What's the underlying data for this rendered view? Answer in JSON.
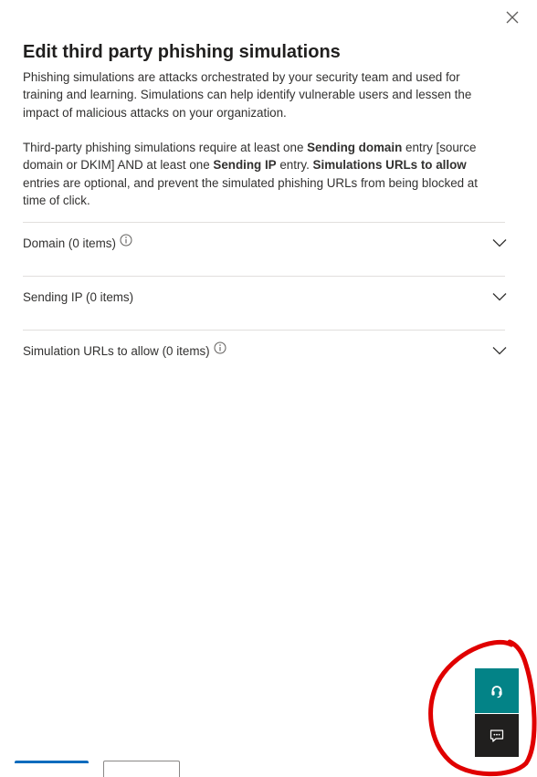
{
  "panel": {
    "title": "Edit third party phishing simulations",
    "description_1": "Phishing simulations are attacks orchestrated by your security team and used for training and learning. Simulations can help identify vulnerable users and lessen the impact of malicious attacks on your organization.",
    "description_2": {
      "part1": "Third-party phishing simulations require at least one ",
      "bold1": "Sending domain",
      "part2": " entry [source domain or DKIM] AND at least one ",
      "bold2": "Sending IP",
      "part3": " entry. ",
      "bold3": "Simulations URLs to allow",
      "part4": " entries are optional, and prevent the simulated phishing URLs from being blocked at time of click."
    },
    "close_icon": "close-icon"
  },
  "sections": [
    {
      "label": "Domain (0 items)",
      "has_info": true,
      "expanded": false
    },
    {
      "label": "Sending IP (0 items)",
      "has_info": false,
      "expanded": false
    },
    {
      "label": "Simulation URLs to allow (0 items)",
      "has_info": true,
      "expanded": false
    }
  ],
  "floating_buttons": {
    "help_icon": "headset-icon",
    "feedback_icon": "feedback-icon",
    "help_color": "#038387",
    "feedback_color": "#201f1e"
  },
  "colors": {
    "primary": "#0f6cbd",
    "annotation": "#e00000"
  }
}
